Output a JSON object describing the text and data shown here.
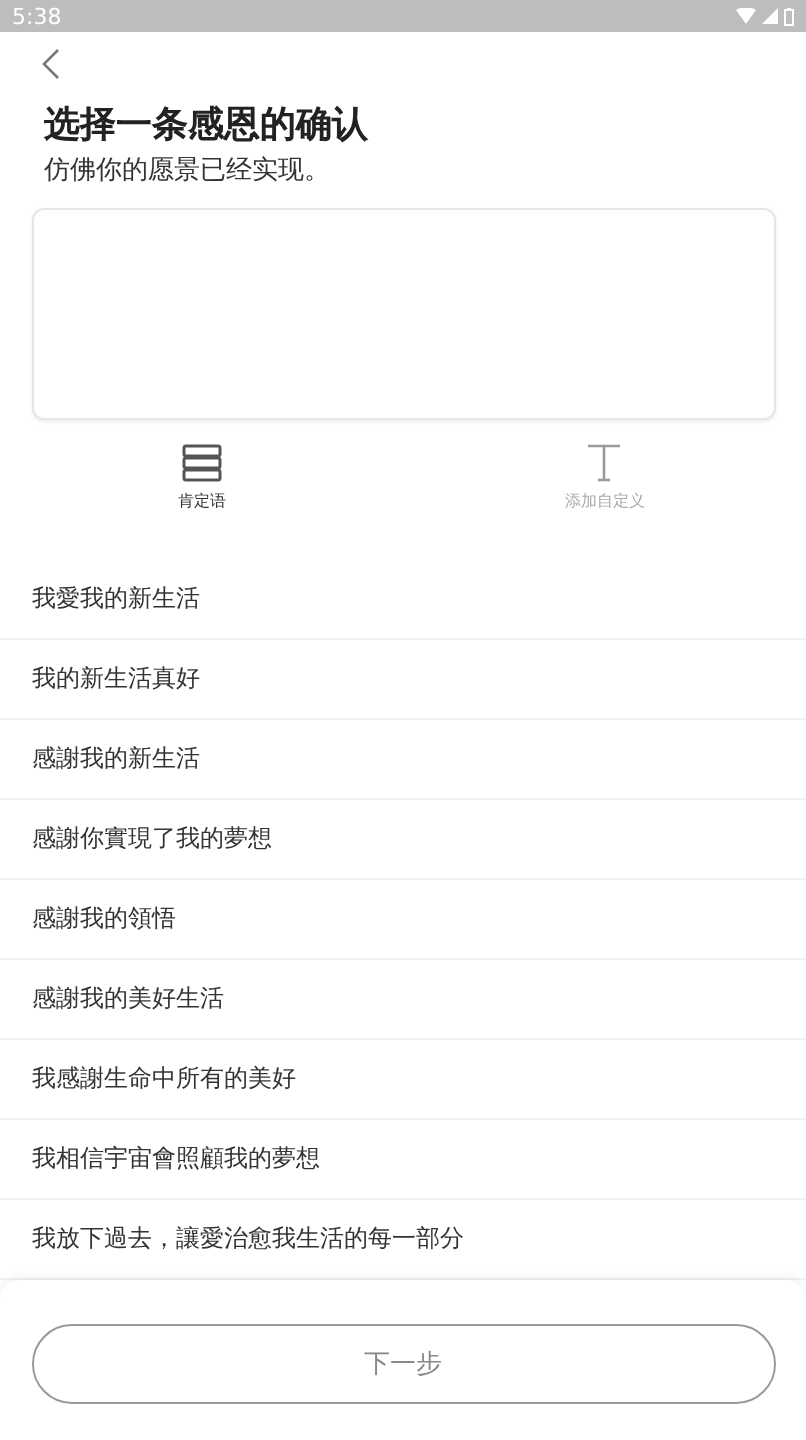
{
  "status_bar": {
    "time": "5:38"
  },
  "header": {
    "title": "选择一条感恩的确认",
    "subtitle": "仿佛你的愿景已经实现。"
  },
  "tabs": [
    {
      "label": "肯定语",
      "kind": "list",
      "selected": true
    },
    {
      "label": "添加自定义",
      "kind": "text",
      "selected": false
    }
  ],
  "affirmations": [
    "我愛我的新生活",
    "我的新生活真好",
    "感謝我的新生活",
    "感謝你實現了我的夢想",
    "感謝我的領悟",
    "感謝我的美好生活",
    "我感謝生命中所有的美好",
    "我相信宇宙會照顧我的夢想",
    "我放下過去，讓愛治愈我生活的每一部分"
  ],
  "next_button": {
    "label": "下一步",
    "disabled": true
  }
}
